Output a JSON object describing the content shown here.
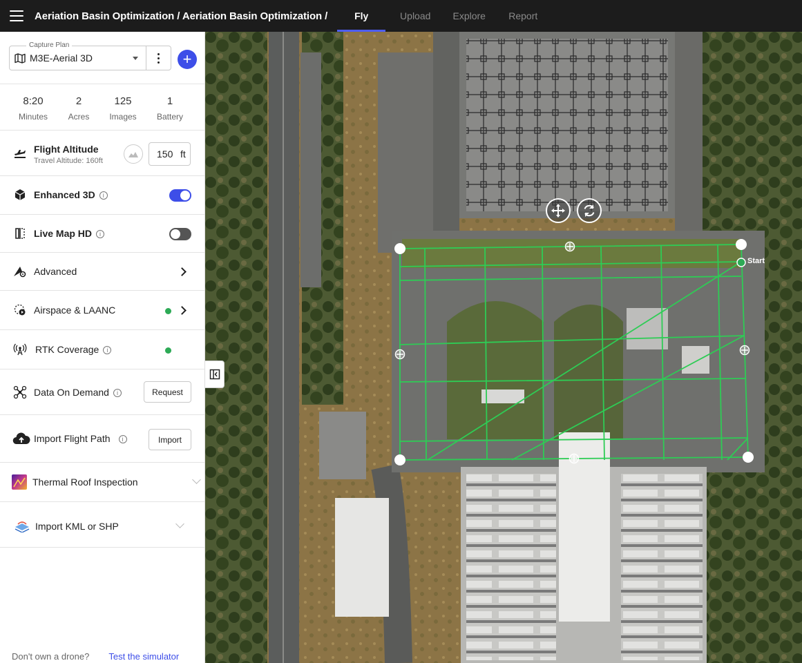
{
  "header": {
    "breadcrumb": "Aeriation Basin Optimization / Aeriation Basin Optimization /",
    "tabs": [
      {
        "label": "Fly",
        "active": true
      },
      {
        "label": "Upload",
        "active": false
      },
      {
        "label": "Explore",
        "active": false
      },
      {
        "label": "Report",
        "active": false
      }
    ]
  },
  "capture_plan": {
    "legend": "Capture Plan",
    "value": "M3E-Aerial 3D",
    "add_label": "+"
  },
  "stats": [
    {
      "value": "8:20",
      "label": "Minutes"
    },
    {
      "value": "2",
      "label": "Acres"
    },
    {
      "value": "125",
      "label": "Images"
    },
    {
      "value": "1",
      "label": "Battery"
    }
  ],
  "flight_altitude": {
    "title": "Flight Altitude",
    "subtitle": "Travel Altitude: 160ft",
    "value": "150",
    "unit": "ft"
  },
  "enhanced_3d": {
    "title": "Enhanced 3D",
    "enabled": true
  },
  "live_map_hd": {
    "title": "Live Map HD",
    "enabled": false
  },
  "advanced": {
    "title": "Advanced"
  },
  "airspace": {
    "title": "Airspace & LAANC",
    "status_color": "#2daa56"
  },
  "rtk": {
    "title": "RTK Coverage",
    "status_color": "#2daa56"
  },
  "data_on_demand": {
    "title": "Data On Demand",
    "button": "Request"
  },
  "import_flight_path": {
    "title": "Import Flight Path",
    "button": "Import"
  },
  "thermal": {
    "title": "Thermal Roof Inspection"
  },
  "import_kml": {
    "title": "Import KML or SHP"
  },
  "footer": {
    "question": "Don't own a drone?",
    "link": "Test the simulator"
  },
  "map": {
    "start_label": "Start",
    "flight_path_color": "#2ecc55",
    "info_glyph": "i"
  },
  "colors": {
    "accent": "#3d4ee8",
    "topbar": "#1c1c1c",
    "status_green": "#2daa56"
  }
}
